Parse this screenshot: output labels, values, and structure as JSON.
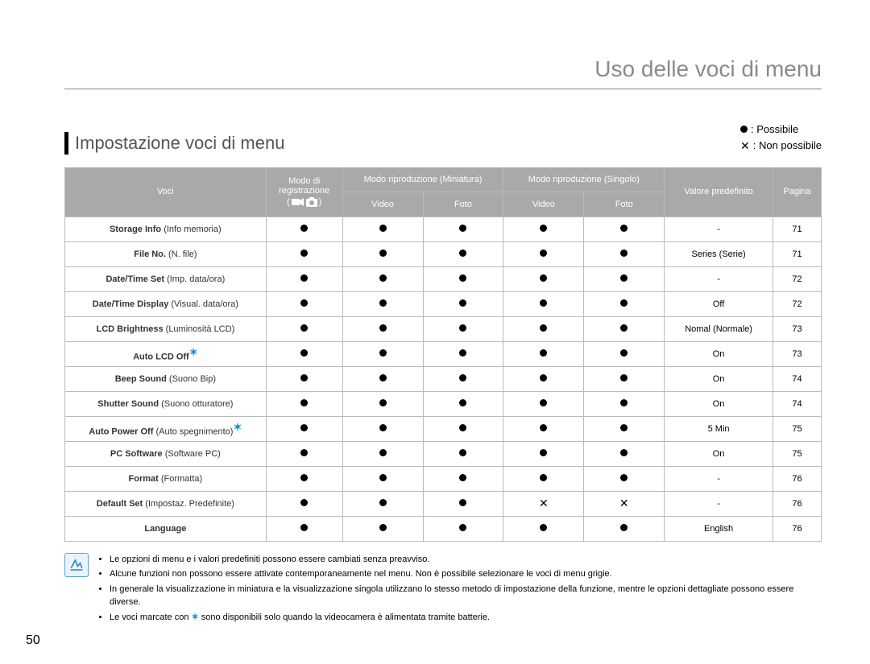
{
  "page_title": "Uso delle voci di menu",
  "section_title": "Impostazione voci di menu",
  "legend": {
    "possible": ": Possibile",
    "not_possible": ": Non possibile"
  },
  "headers": {
    "voci": "Voci",
    "rec_mode_line1": "Modo di",
    "rec_mode_line2": "registrazione",
    "play_thumb": "Modo riproduzione (Miniatura)",
    "play_single": "Modo riproduzione (Singolo)",
    "video": "Video",
    "photo": "Foto",
    "default": "Valore predefinito",
    "page": "Pagina"
  },
  "rows": [
    {
      "b": "Storage Info",
      "l": " (Info memoria)",
      "c": [
        "dot",
        "dot",
        "dot",
        "dot",
        "dot"
      ],
      "def": "-",
      "pg": "71",
      "star": false
    },
    {
      "b": "File No.",
      "l": " (N. file)",
      "c": [
        "dot",
        "dot",
        "dot",
        "dot",
        "dot"
      ],
      "def": "Series (Serie)",
      "pg": "71",
      "star": false
    },
    {
      "b": "Date/Time Set",
      "l": " (Imp. data/ora)",
      "c": [
        "dot",
        "dot",
        "dot",
        "dot",
        "dot"
      ],
      "def": "-",
      "pg": "72",
      "star": false
    },
    {
      "b": "Date/Time Display",
      "l": " (Visual. data/ora)",
      "c": [
        "dot",
        "dot",
        "dot",
        "dot",
        "dot"
      ],
      "def": "Off",
      "pg": "72",
      "star": false
    },
    {
      "b": "LCD Brightness",
      "l": " (Luminosità LCD)",
      "c": [
        "dot",
        "dot",
        "dot",
        "dot",
        "dot"
      ],
      "def": "Nomal (Normale)",
      "pg": "73",
      "star": false
    },
    {
      "b": "Auto LCD Off",
      "l": "",
      "c": [
        "dot",
        "dot",
        "dot",
        "dot",
        "dot"
      ],
      "def": "On",
      "pg": "73",
      "star": true
    },
    {
      "b": "Beep Sound",
      "l": " (Suono Bip)",
      "c": [
        "dot",
        "dot",
        "dot",
        "dot",
        "dot"
      ],
      "def": "On",
      "pg": "74",
      "star": false
    },
    {
      "b": "Shutter Sound",
      "l": " (Suono otturatore)",
      "c": [
        "dot",
        "dot",
        "dot",
        "dot",
        "dot"
      ],
      "def": "On",
      "pg": "74",
      "star": false
    },
    {
      "b": "Auto Power Off",
      "l": " (Auto spegnimento)",
      "c": [
        "dot",
        "dot",
        "dot",
        "dot",
        "dot"
      ],
      "def": "5 Min",
      "pg": "75",
      "star": true
    },
    {
      "b": "PC Software",
      "l": " (Software PC)",
      "c": [
        "dot",
        "dot",
        "dot",
        "dot",
        "dot"
      ],
      "def": "On",
      "pg": "75",
      "star": false
    },
    {
      "b": "Format",
      "l": " (Formatta)",
      "c": [
        "dot",
        "dot",
        "dot",
        "dot",
        "dot"
      ],
      "def": "-",
      "pg": "76",
      "star": false
    },
    {
      "b": "Default Set",
      "l": " (Impostaz. Predefinite)",
      "c": [
        "dot",
        "dot",
        "dot",
        "cross",
        "cross"
      ],
      "def": "-",
      "pg": "76",
      "star": false
    },
    {
      "b": "Language",
      "l": "",
      "c": [
        "dot",
        "dot",
        "dot",
        "dot",
        "dot"
      ],
      "def": "English",
      "pg": "76",
      "star": false
    }
  ],
  "notes": [
    "Le opzioni di menu e i valori predefiniti possono essere cambiati senza preavviso.",
    "Alcune funzioni non possono essere attivate contemporaneamente nel menu. Non è possibile selezionare le voci di menu grigie.",
    "In generale la visualizzazione in miniatura e la visualizzazione singola utilizzano lo stesso metodo di impostazione della funzione, mentre le opzioni dettagliate possono essere diverse."
  ],
  "note_star_prefix": "Le voci marcate con ",
  "note_star_suffix": " sono disponibili solo quando la videocamera è alimentata tramite batterie.",
  "page_number": "50",
  "star_symbol": "✶"
}
